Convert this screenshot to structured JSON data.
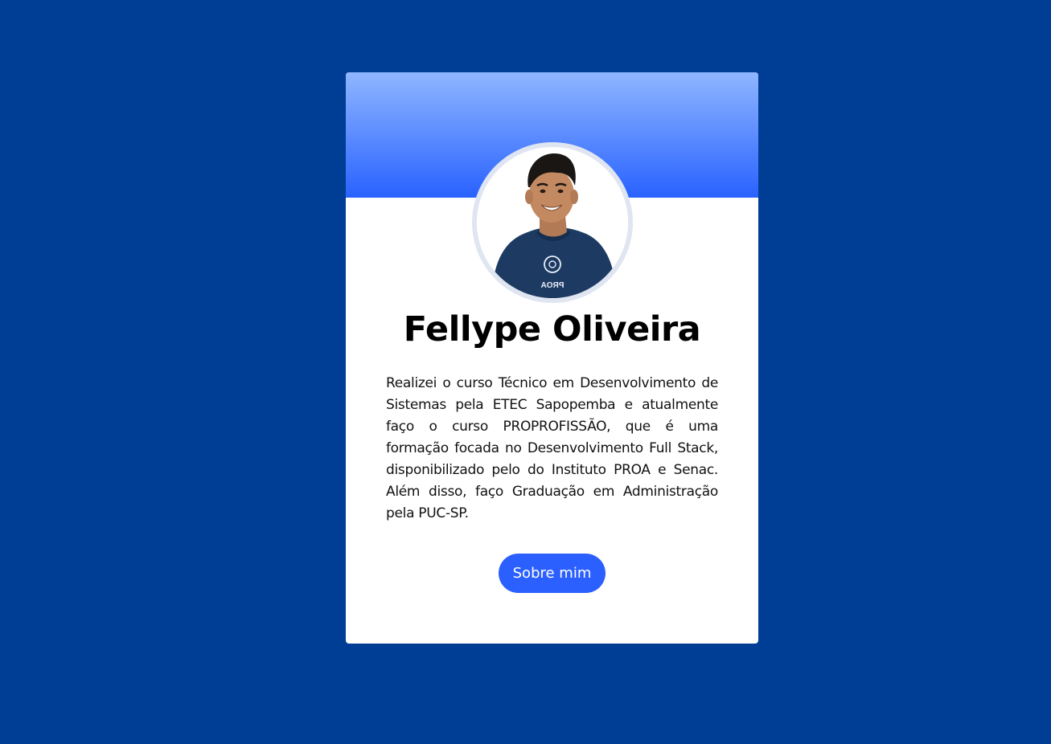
{
  "profile": {
    "name": "Fellype Oliveira",
    "bio": "Realizei o curso Técnico em Desenvolvimento de Sistemas pela ETEC Sapopemba e atualmente faço o curso PROPROFISSÃO, que é uma formação focada no Desenvolvimento Full Stack, disponibilizado pelo do Instituto PROA e Senac. Além disso, faço Graduação em Administração pela PUC-SP.",
    "photo_alt": "Fellype Oliveira",
    "shirt_logo_text": "PROA"
  },
  "actions": {
    "about_label": "Sobre mim"
  },
  "theme": {
    "page_background": "#003e95",
    "header_gradient_top": "#8fb6ff",
    "header_gradient_bottom": "#2962ff",
    "button_color": "#2b60ff",
    "card_background": "#ffffff"
  }
}
